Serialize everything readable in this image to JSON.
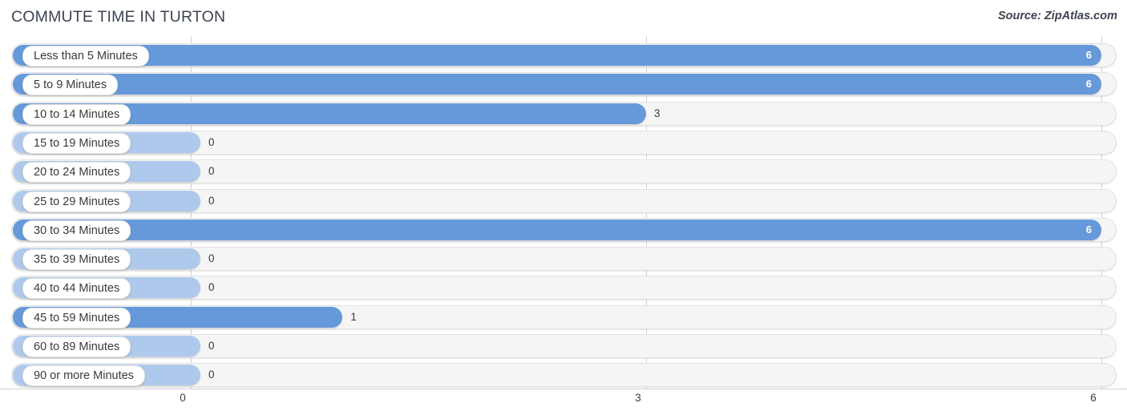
{
  "header": {
    "title": "COMMUTE TIME IN TURTON",
    "source": "Source: ZipAtlas.com"
  },
  "colors": {
    "bar_full": "#6699da",
    "bar_faded": "#aec9ec",
    "track": "#f5f5f5",
    "gridline": "#d2d2d2",
    "text": "#3a3a3a"
  },
  "axis": {
    "ticks": [
      "0",
      "3",
      "6"
    ],
    "tick_values": [
      0,
      3,
      6
    ],
    "min": 0,
    "max": 6
  },
  "chart_data": {
    "type": "bar",
    "orientation": "horizontal",
    "title": "COMMUTE TIME IN TURTON",
    "subtitle": "Source: ZipAtlas.com",
    "xlabel": "",
    "ylabel": "",
    "xlim": [
      0,
      6
    ],
    "xticks": [
      0,
      3,
      6
    ],
    "grid": true,
    "legend": "none",
    "categories": [
      "Less than 5 Minutes",
      "5 to 9 Minutes",
      "10 to 14 Minutes",
      "15 to 19 Minutes",
      "20 to 24 Minutes",
      "25 to 29 Minutes",
      "30 to 34 Minutes",
      "35 to 39 Minutes",
      "40 to 44 Minutes",
      "45 to 59 Minutes",
      "60 to 89 Minutes",
      "90 or more Minutes"
    ],
    "values": [
      6,
      6,
      3,
      0,
      0,
      0,
      6,
      0,
      0,
      1,
      0,
      0
    ],
    "value_labels": [
      "6",
      "6",
      "3",
      "0",
      "0",
      "0",
      "6",
      "0",
      "0",
      "1",
      "0",
      "0"
    ]
  },
  "rows": [
    {
      "label": "Less than 5 Minutes",
      "value": 6,
      "value_label": "6",
      "inside": true,
      "style": "full"
    },
    {
      "label": "5 to 9 Minutes",
      "value": 6,
      "value_label": "6",
      "inside": true,
      "style": "full"
    },
    {
      "label": "10 to 14 Minutes",
      "value": 3,
      "value_label": "3",
      "inside": false,
      "style": "full"
    },
    {
      "label": "15 to 19 Minutes",
      "value": 0,
      "value_label": "0",
      "inside": false,
      "style": "faded"
    },
    {
      "label": "20 to 24 Minutes",
      "value": 0,
      "value_label": "0",
      "inside": false,
      "style": "faded"
    },
    {
      "label": "25 to 29 Minutes",
      "value": 0,
      "value_label": "0",
      "inside": false,
      "style": "faded"
    },
    {
      "label": "30 to 34 Minutes",
      "value": 6,
      "value_label": "6",
      "inside": true,
      "style": "full"
    },
    {
      "label": "35 to 39 Minutes",
      "value": 0,
      "value_label": "0",
      "inside": false,
      "style": "faded"
    },
    {
      "label": "40 to 44 Minutes",
      "value": 0,
      "value_label": "0",
      "inside": false,
      "style": "faded"
    },
    {
      "label": "45 to 59 Minutes",
      "value": 1,
      "value_label": "1",
      "inside": false,
      "style": "full"
    },
    {
      "label": "60 to 89 Minutes",
      "value": 0,
      "value_label": "0",
      "inside": false,
      "style": "faded"
    },
    {
      "label": "90 or more Minutes",
      "value": 0,
      "value_label": "0",
      "inside": false,
      "style": "faded"
    }
  ]
}
